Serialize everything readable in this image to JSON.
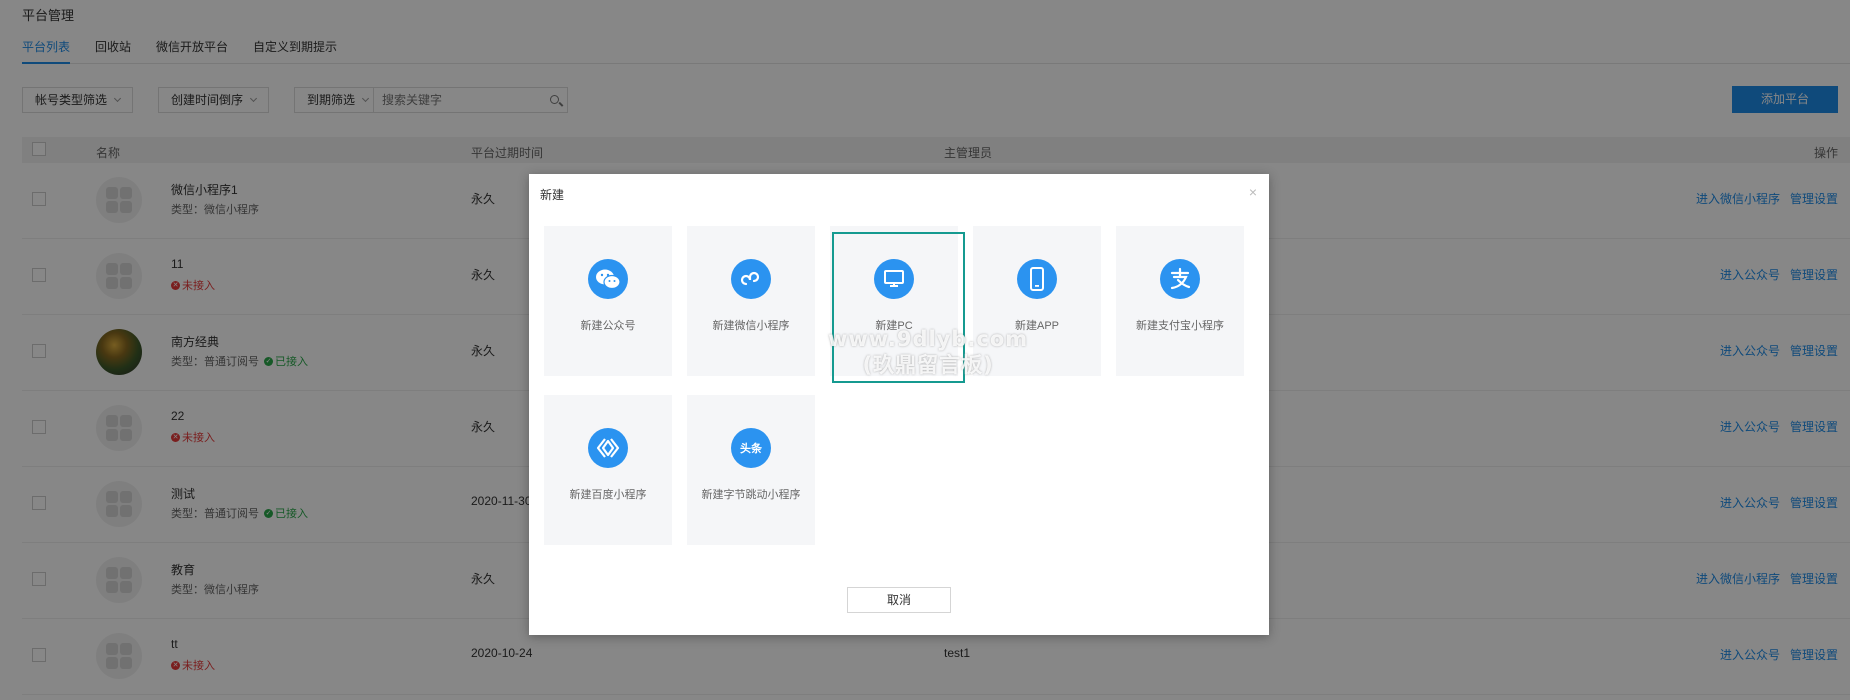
{
  "page": {
    "title": "平台管理",
    "tabs": [
      {
        "label": "平台列表",
        "active": true
      },
      {
        "label": "回收站"
      },
      {
        "label": "微信开放平台"
      },
      {
        "label": "自定义到期提示"
      }
    ]
  },
  "filters": {
    "account_type": "帐号类型筛选",
    "created_order": "创建时间倒序",
    "expire_filter": "到期筛选",
    "search_placeholder": "搜索关键字",
    "add_button": "添加平台"
  },
  "table": {
    "headers": {
      "name": "名称",
      "expire": "平台过期时间",
      "admin": "主管理员",
      "ops": "操作"
    },
    "rows": [
      {
        "name": "微信小程序1",
        "type": "类型：微信小程序",
        "status": "",
        "expire": "永久",
        "admin": "",
        "op1": "进入微信小程序",
        "op2": "管理设置"
      },
      {
        "name": "11",
        "type": "",
        "status": "未接入",
        "expire": "永久",
        "admin": "",
        "op1": "进入公众号",
        "op2": "管理设置"
      },
      {
        "name": "南方经典",
        "type": "类型：普通订阅号",
        "status": "已接入",
        "expire": "永久",
        "admin": "",
        "op1": "进入公众号",
        "op2": "管理设置"
      },
      {
        "name": "22",
        "type": "",
        "status": "未接入",
        "expire": "永久",
        "admin": "",
        "op1": "进入公众号",
        "op2": "管理设置"
      },
      {
        "name": "测试",
        "type": "类型：普通订阅号",
        "status": "已接入",
        "expire": "2020-11-30",
        "admin": "",
        "op1": "进入公众号",
        "op2": "管理设置"
      },
      {
        "name": "教育",
        "type": "类型：微信小程序",
        "status": "",
        "expire": "永久",
        "admin": "",
        "op1": "进入微信小程序",
        "op2": "管理设置"
      },
      {
        "name": "tt",
        "type": "",
        "status": "未接入",
        "expire": "2020-10-24",
        "admin": "test1",
        "op1": "进入公众号",
        "op2": "管理设置"
      }
    ]
  },
  "modal": {
    "title": "新建",
    "close": "×",
    "cards": [
      {
        "label": "新建公众号",
        "icon": "wechat-icon"
      },
      {
        "label": "新建微信小程序",
        "icon": "miniprogram-icon"
      },
      {
        "label": "新建PC",
        "icon": "monitor-icon"
      },
      {
        "label": "新建APP",
        "icon": "phone-icon"
      },
      {
        "label": "新建支付宝小程序",
        "icon": "alipay-icon"
      },
      {
        "label": "新建百度小程序",
        "icon": "baidu-smartprogram-icon"
      },
      {
        "label": "新建字节跳动小程序",
        "icon": "toutiao-icon",
        "icon_text": "头条"
      }
    ],
    "cancel": "取消"
  },
  "watermark": {
    "line1": "www.9dlyb.com",
    "line2": "(玖鼎留言板)"
  },
  "colors": {
    "accent": "#1e8ce8",
    "selection": "#159a90",
    "red": "#e63a3a",
    "green": "#2aa84a"
  }
}
